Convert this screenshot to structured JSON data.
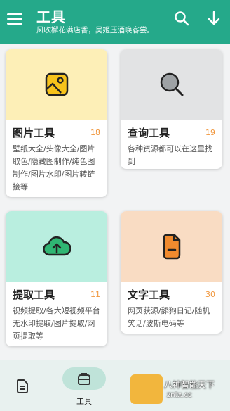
{
  "colors": {
    "accent": "#25a98a",
    "count": "#f0963c"
  },
  "header": {
    "title": "工具",
    "subtitle": "风吹檞花满店香，吴姬压酒唤客尝。",
    "icons": [
      "menu-icon",
      "search-icon",
      "arrow-down-icon"
    ]
  },
  "cards": [
    {
      "title": "图片工具",
      "count": "18",
      "desc": "壁纸大全/头像大全/图片取色/隐藏图制作/纯色图制作/图片水印/图片转链接等",
      "color": "#fdefb7",
      "icon": "image-icon"
    },
    {
      "title": "查询工具",
      "count": "19",
      "desc": "各种资源都可以在这里找到",
      "color": "#e2e3e4",
      "icon": "search-icon"
    },
    {
      "title": "提取工具",
      "count": "11",
      "desc": "视频提取/各大短视频平台无水印提取/图片提取/网页提取等",
      "color": "#b9eedf",
      "icon": "cloud-upload-icon"
    },
    {
      "title": "文字工具",
      "count": "30",
      "desc": "网页获源/舔狗日记/随机笑话/波斯电码等",
      "color": "#f9dcc3",
      "icon": "document-icon"
    }
  ],
  "bottom_nav": {
    "tools_label": "工具",
    "icons": [
      "document-icon",
      "toolbox-icon"
    ]
  },
  "watermark": {
    "line1": "八神智能天下",
    "line2": "zntx.cc"
  }
}
